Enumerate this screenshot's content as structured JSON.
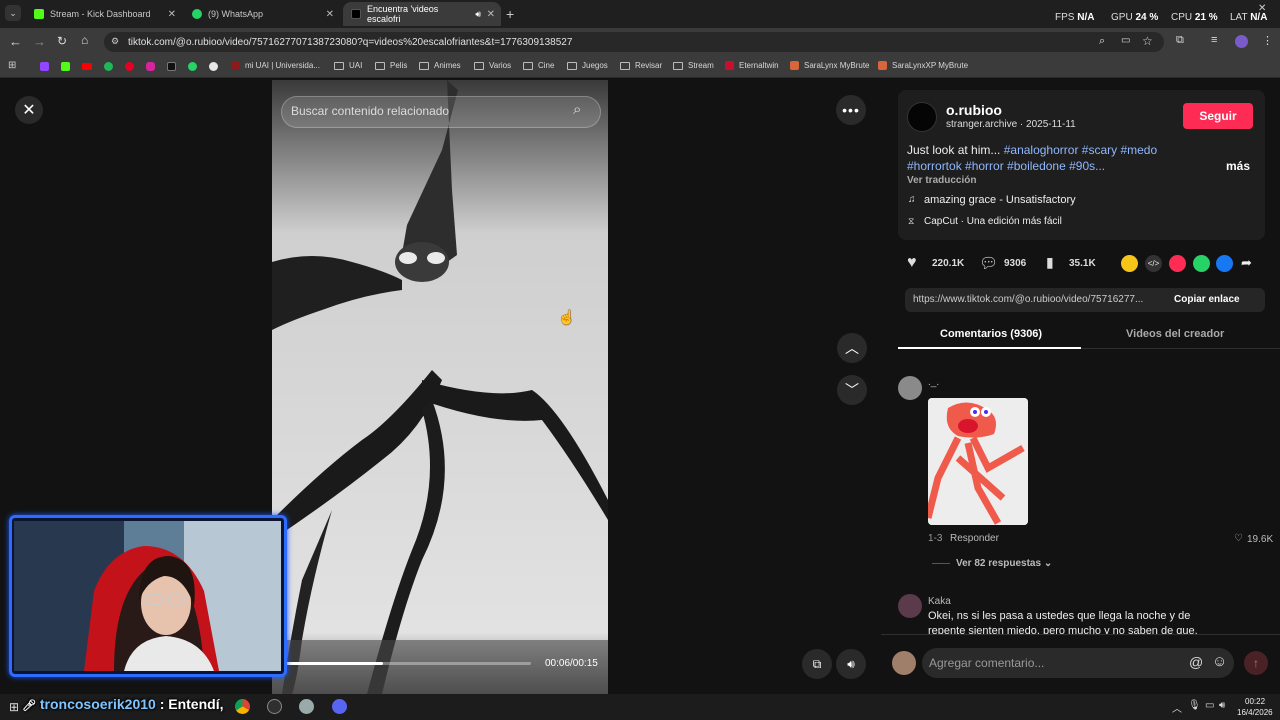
{
  "tabs": [
    {
      "title": "Stream - Kick Dashboard",
      "color": "#53fc18"
    },
    {
      "title": "(9) WhatsApp",
      "color": "#25d366"
    },
    {
      "title": "Encuentra 'videos escalofri",
      "color": "#000000"
    }
  ],
  "perf": {
    "fps_label": "FPS",
    "fps": "N/A",
    "gpu_label": "GPU",
    "gpu": "24 %",
    "cpu_label": "CPU",
    "cpu": "21 %",
    "lat_label": "LAT",
    "lat": "N/A"
  },
  "address": {
    "url": "tiktok.com/@o.rubioo/video/7571627707138723080?q=videos%20escalofriantes&t=1776309138527"
  },
  "bookmarks": [
    "mi UAI | Universida...",
    "UAI",
    "Pelis",
    "Animes",
    "Varios",
    "Cine",
    "Juegos",
    "Revisar",
    "Stream",
    "Eternaltwin",
    "SaraLynx MyBrute",
    "SaraLynxXP MyBrute"
  ],
  "video": {
    "search_placeholder": "Buscar contenido relacionado",
    "time": "00:06/00:15",
    "progress": 0.4
  },
  "post": {
    "username": "o.rubioo",
    "meta_user": "stranger.archive",
    "date": "2025-11-11",
    "follow_label": "Seguir",
    "caption_start": "Just look at him...",
    "tags_line1": "#analoghorror #scary #medo",
    "tags_line2": "#horrortok #horror #boiledone #90s...",
    "more_label": "más",
    "translate_label": "Ver traducción",
    "music": "amazing grace - Unsatisfactory",
    "capcut": "CapCut · Una edición más fácil",
    "likes": "220.1K",
    "comments": "9306",
    "saves": "35.1K",
    "link": "https://www.tiktok.com/@o.rubioo/video/75716277...",
    "copy_label": "Copiar enlace"
  },
  "panel_tabs": {
    "comments": "Comentarios (9306)",
    "creator": "Videos del creador"
  },
  "comments": [
    {
      "user": "._.",
      "date": "1-3",
      "reply": "Responder",
      "likes": "19.6K",
      "replies": "Ver 82 respuestas"
    },
    {
      "user": "Kaka",
      "text1": "Okei, ns si les pasa a ustedes que llega la noche y de",
      "text2": "repente sienten miedo, pero mucho y no saben de que."
    }
  ],
  "comment_input_placeholder": "Agregar comentario...",
  "stream_chat": {
    "user": "troncosoerik2010",
    "message": ": Entendí,"
  },
  "clock": {
    "time": "00:22",
    "date": "16/4/2026"
  }
}
